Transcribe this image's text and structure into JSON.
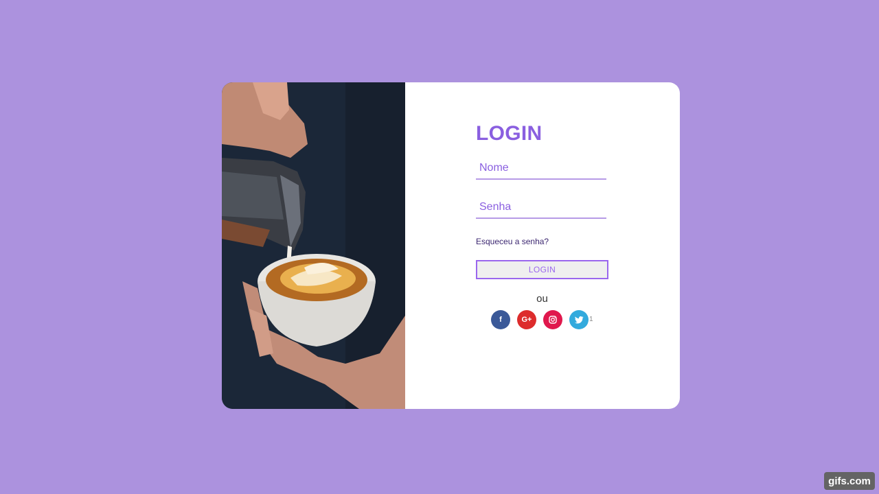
{
  "login": {
    "title": "LOGIN",
    "username_placeholder": "Nome",
    "password_placeholder": "Senha",
    "forgot_link": "Esqueceu a senha?",
    "submit_label": "LOGIN",
    "divider": "ou"
  },
  "social": {
    "buttons": [
      {
        "name": "facebook",
        "glyph": "f",
        "color": "#3b5998"
      },
      {
        "name": "google-plus",
        "glyph": "G+",
        "color": "#dd2c2c"
      },
      {
        "name": "instagram",
        "glyph": "◎",
        "color": "#e0184d"
      },
      {
        "name": "twitter",
        "glyph": "🐦",
        "color": "#33aadd"
      }
    ],
    "count": "1"
  },
  "colors": {
    "background": "#ac92de",
    "accent": "#8a5fe0",
    "card": "#ffffff"
  },
  "watermark": "gifs.com"
}
